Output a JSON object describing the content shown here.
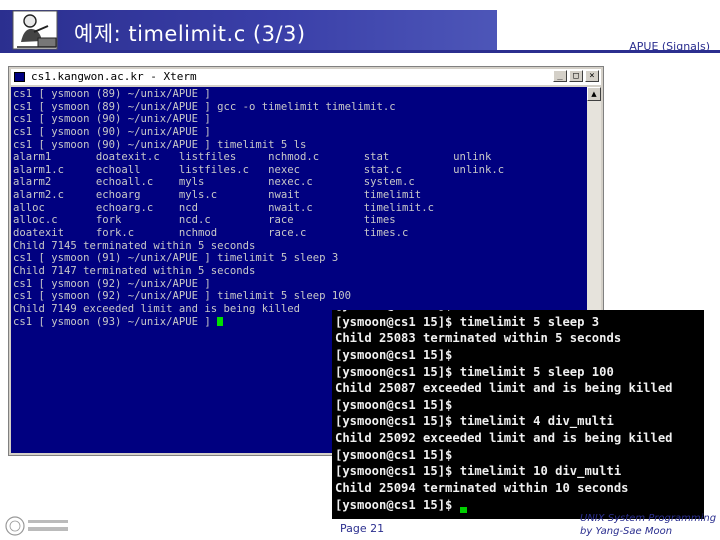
{
  "slide": {
    "title": "예제: timelimit.c (3/3)",
    "tag": "APUE (Signals)",
    "page": "Page 21",
    "credit_line1": "UNIX System Programming",
    "credit_line2": "by Yang-Sae Moon"
  },
  "xterm": {
    "title": "cs1.kangwon.ac.kr - Xterm",
    "minimize": "_",
    "maximize": "□",
    "close": "×",
    "lines": [
      "cs1 [ ysmoon (89) ~/unix/APUE ]",
      "cs1 [ ysmoon (89) ~/unix/APUE ] gcc -o timelimit timelimit.c",
      "cs1 [ ysmoon (90) ~/unix/APUE ]",
      "cs1 [ ysmoon (90) ~/unix/APUE ]",
      "cs1 [ ysmoon (90) ~/unix/APUE ] timelimit 5 ls",
      "alarm1       doatexit.c   listfiles     nchmod.c       stat          unlink",
      "alarm1.c     echoall      listfiles.c   nexec          stat.c        unlink.c",
      "alarm2       echoall.c    myls          nexec.c        system.c",
      "alarm2.c     echoarg      myls.c        nwait          timelimit",
      "alloc        echoarg.c    ncd           nwait.c        timelimit.c",
      "alloc.c      fork         ncd.c         race           times",
      "doatexit     fork.c       nchmod        race.c         times.c",
      "Child 7145 terminated within 5 seconds",
      "cs1 [ ysmoon (91) ~/unix/APUE ] timelimit 5 sleep 3",
      "Child 7147 terminated within 5 seconds",
      "cs1 [ ysmoon (92) ~/unix/APUE ]",
      "cs1 [ ysmoon (92) ~/unix/APUE ] timelimit 5 sleep 100",
      "Child 7149 exceeded limit and is being killed",
      "cs1 [ ysmoon (93) ~/unix/APUE ] "
    ]
  },
  "linux_term": {
    "lines": [
      "[ysmoon@cs1 15]$",
      "[ysmoon@cs1 15]$ timelimit 5 sleep 3",
      "Child 25083 terminated within 5 seconds",
      "[ysmoon@cs1 15]$",
      "[ysmoon@cs1 15]$ timelimit 5 sleep 100",
      "Child 25087 exceeded limit and is being killed",
      "[ysmoon@cs1 15]$",
      "[ysmoon@cs1 15]$ timelimit 4 div_multi",
      "Child 25092 exceeded limit and is being killed",
      "[ysmoon@cs1 15]$",
      "[ysmoon@cs1 15]$ timelimit 10 div_multi",
      "Child 25094 terminated within 10 seconds",
      "[ysmoon@cs1 15]$ "
    ]
  },
  "colors": {
    "accent": "#2b2f8f",
    "xterm_bg": "#000080",
    "linux_bg": "#000000",
    "cursor": "#00e000"
  },
  "icons": {
    "header": "professor-at-desk-icon",
    "footer": "university-logo"
  }
}
